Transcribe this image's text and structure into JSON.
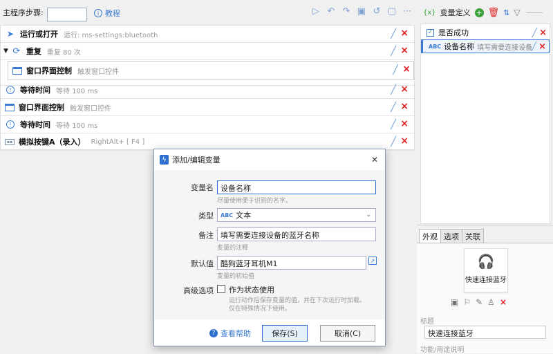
{
  "toolbar": {
    "main_steps_label": "主程序步骤:",
    "tutorial_label": "教程",
    "icons": [
      "play-icon",
      "undo-icon",
      "redo-icon",
      "save-icon",
      "history-icon",
      "notes-icon",
      "more-icon"
    ]
  },
  "steps": [
    {
      "name": "运行或打开",
      "desc": "运行: ms-settings:bluetooth",
      "icon": "send-icon"
    },
    {
      "name": "重复",
      "desc": "重复 80 次",
      "icon": "repeat-icon"
    },
    {
      "name": "窗口界面控制",
      "desc": "触发窗口控件",
      "icon": "window-icon"
    },
    {
      "name": "等待时间",
      "desc": "等待 100 ms",
      "icon": "clock-icon"
    },
    {
      "name": "窗口界面控制",
      "desc": "触发窗口控件",
      "icon": "window-icon"
    },
    {
      "name": "等待时间",
      "desc": "等待 100 ms",
      "icon": "clock-icon"
    },
    {
      "name": "模拟按键A（录入）",
      "desc": "RightAlt+ [ F4 ]",
      "icon": "keyboard-icon"
    }
  ],
  "variables": {
    "header": "变量定义",
    "items": [
      {
        "name": "是否成功",
        "desc": "",
        "type_icon": "checkbox-icon"
      },
      {
        "name": "设备名称",
        "desc": "填写需要连接设备的蓝牙名称",
        "type_icon": "abc-icon"
      }
    ]
  },
  "appearance": {
    "tabs": [
      "外观",
      "选项",
      "关联"
    ],
    "card_title": "快速连接蓝牙",
    "title_label": "标题",
    "title_value": "快速连接蓝牙",
    "desc_label": "功能/用途说明"
  },
  "dialog": {
    "title": "添加/编辑变量",
    "var_name_label": "变量名",
    "var_name_value": "设备名称",
    "var_name_hint": "尽量使用便于识别的名字。",
    "type_label": "类型",
    "type_value": "文本",
    "type_badge": "ABC",
    "note_label": "备注",
    "note_value": "填写需要连接设备的蓝牙名称",
    "note_hint": "变量的注释",
    "default_label": "默认值",
    "default_value": "酷狗蓝牙耳机M1",
    "default_hint": "变量的初始值",
    "advanced_label": "高级选项",
    "state_checkbox_label": "作为状态使用",
    "state_hint1": "运行动作后保存变量的值，并在下次运行时加载。",
    "state_hint2": "仅在特殊情况下使用。",
    "help_label": "查看帮助",
    "save_label": "保存(S)",
    "cancel_label": "取消(C)"
  },
  "colors": {
    "accent": "#2f6fd0",
    "danger": "#e02020",
    "link": "#3a7bd5"
  }
}
